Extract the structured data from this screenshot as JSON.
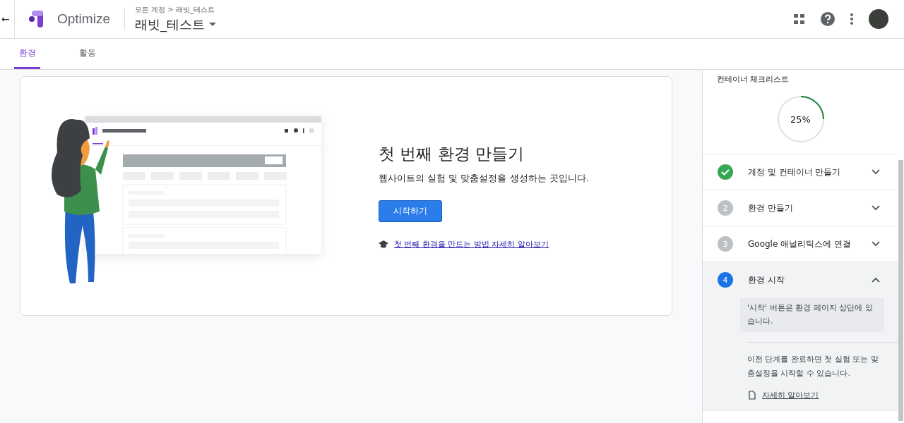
{
  "header": {
    "back_icon": "←",
    "product": "Optimize",
    "breadcrumb": "모든 계정 > 래빗_테스트",
    "container": "래빗_테스트"
  },
  "tabs": [
    {
      "label": "환경",
      "selected": true
    },
    {
      "label": "활동",
      "selected": false
    }
  ],
  "empty_state": {
    "title": "첫 번째 환경 만들기",
    "description": "웹사이트의 실험 및 맞춤설정을 생성하는 곳입니다.",
    "button": "시작하기",
    "link": "첫 번째 환경을 만드는 방법 자세히 알아보기"
  },
  "checklist": {
    "title": "컨테이너 체크리스트",
    "level": 0.25,
    "percent": "25%",
    "steps": [
      {
        "kind": "done",
        "label": "계정 및 컨테이너 만들기",
        "expanded": false
      },
      {
        "kind": "pending",
        "number": "2",
        "label": "환경 만들기",
        "expanded": false
      },
      {
        "kind": "pending",
        "number": "3",
        "label": "Google 애널리틱스에 연결",
        "expanded": false
      },
      {
        "kind": "active",
        "number": "4",
        "label": "환경 시작",
        "expanded": true,
        "note": "'시작' 버튼은 환경 페이지 상단에 있습니다.",
        "body": "이전 단계를 완료하면 첫 실험 또는 맞춤설정을 시작할 수 있습니다.",
        "link": "자세히 알아보기"
      }
    ]
  }
}
